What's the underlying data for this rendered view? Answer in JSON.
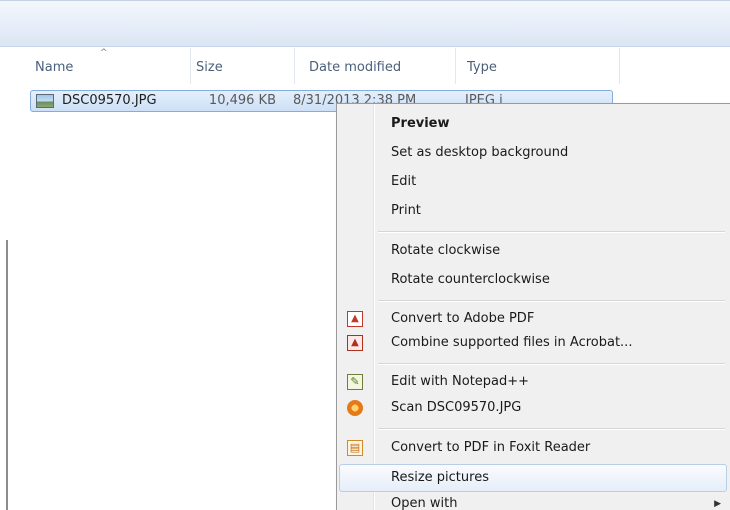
{
  "columns": {
    "name": "Name",
    "size": "Size",
    "date_modified": "Date modified",
    "type": "Type"
  },
  "file": {
    "name": "DSC09570.JPG",
    "size": "10,496 KB",
    "date": "8/31/2013 2:38 PM",
    "type": "JPEG i"
  },
  "context_menu": {
    "preview": "Preview",
    "set_background": "Set as desktop background",
    "edit": "Edit",
    "print": "Print",
    "rotate_cw": "Rotate clockwise",
    "rotate_ccw": "Rotate counterclockwise",
    "convert_adobe": "Convert to Adobe PDF",
    "combine_acrobat": "Combine supported files in Acrobat...",
    "edit_notepad": "Edit with Notepad++",
    "scan": "Scan DSC09570.JPG",
    "convert_foxit": "Convert to PDF in Foxit Reader",
    "resize": "Resize pictures",
    "open_with": "Open with"
  },
  "icons": {
    "sort": "sort-ascending-icon",
    "file": "image-file-icon",
    "pdf": "adobe-pdf-icon",
    "combine": "acrobat-combine-icon",
    "notepad": "notepad-plus-plus-icon",
    "scan": "antivirus-scan-icon",
    "foxit": "foxit-pdf-icon",
    "submenu": "submenu-arrow-icon"
  }
}
